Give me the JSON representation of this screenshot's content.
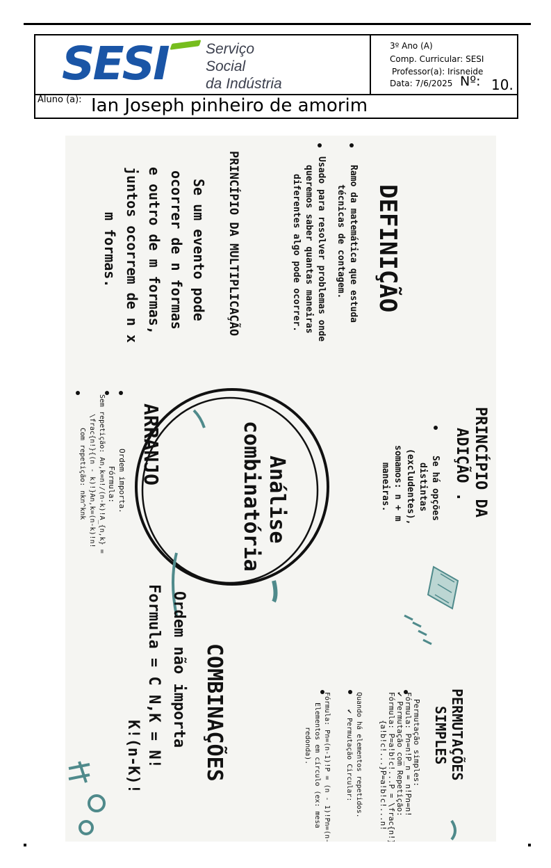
{
  "header": {
    "logo_word": "SESI",
    "logo_lines": [
      "Serviço",
      "Social",
      "da Indústria"
    ],
    "info": {
      "year": "3º Ano (A)",
      "component": "Comp. Curricular: SESI",
      "teacher": "Professor(a):  Irisneide",
      "date": "Data: 7/6/2025"
    },
    "number_label": "Nº:",
    "number_value": "10.",
    "student_label": "Aluno (a):",
    "student_name": "Ian Joseph pinheiro de amorim"
  },
  "mindmap": {
    "center": [
      "Análise",
      "combinatória"
    ],
    "definicao": {
      "title": "DEFINIÇÃO",
      "bullets": [
        [
          "Ramo da matemática que estuda",
          "técnicas de contagem."
        ],
        [
          "Usado para resolver problemas onde",
          "queremos saber quantas maneiras",
          "diferentes algo pode ocorrer."
        ]
      ]
    },
    "multiplicacao": {
      "title": "PRINCÍPIO DA MULTIPLICAÇÃO",
      "lines": [
        "Se um evento pode",
        "ocorrer de n formas",
        "e outro de m formas,",
        "juntos ocorrem de n x",
        "m formas."
      ]
    },
    "adicao": {
      "title": [
        "PRINCÍPIO DA",
        "ADIÇÃO ."
      ],
      "lines": [
        "Se há opções",
        "distintas",
        "(excludentes),",
        "somamos: n + m",
        "maneiras."
      ]
    },
    "arranjo": {
      "title": "ARRANJO",
      "lines": [
        "Ordem importa.",
        "Fórmula:",
        "Sem repetição: An,k=n!/(n-k)!A_{n,k} =",
        "\\frac{n!}{(n - k)!}An,k=(n-k)!n!",
        "Com repetição: nkn^knk"
      ]
    },
    "combinacoes": {
      "title": "COMBINAÇÕES",
      "lines": [
        "Ordem não importa",
        "Formula = C N,K = N!",
        "K!(n-K)!"
      ]
    },
    "permutacoes": {
      "title": [
        "PERMUTAÇÕES",
        "SIMPLES"
      ],
      "lines": [
        "Permutação simples:",
        "Fórmula: Pn=n!P_n = n!Pn=n!",
        "✔ Permutação com Repetição:",
        "Fórmula: P=a!b!c!...P = \\frac{n!}",
        "{a!b!c!...}P=a!b!c!...n!",
        "Quando há elementos repetidos.",
        "✔ Permutação Circular:",
        "Fórmula: Pn=(n-1)!P = (n - 1)!Pn=(n-1)!",
        "Elementos em círculo (ex: mesa",
        "redonda)."
      ]
    },
    "colors": {
      "background": "#f5f5f2",
      "teal": "#4f8a8b",
      "ink": "#111111"
    }
  }
}
